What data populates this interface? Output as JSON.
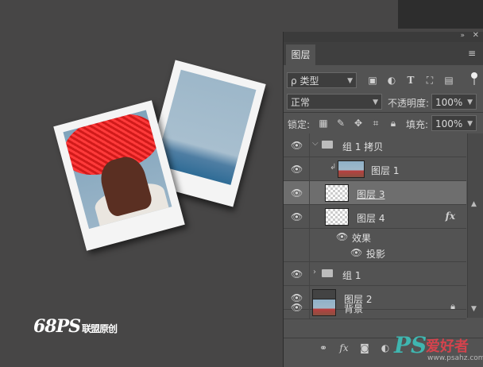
{
  "canvas": {
    "logo_main": "68PS",
    "logo_sub": "联盟原创"
  },
  "panel": {
    "collapse_icon": "»",
    "close_icon": "✕",
    "tab_label": "图层",
    "menu_icon": "≡",
    "filter": {
      "search_prefix": "ρ",
      "kind_value": "类型"
    },
    "blend_mode": "正常",
    "opacity_label": "不透明度:",
    "opacity_value": "100%",
    "lock_label": "锁定:",
    "fill_label": "填充:",
    "fill_value": "100%",
    "layers": [
      {
        "name": "组 1 拷贝",
        "type": "group",
        "expanded": true
      },
      {
        "name": "图层 1",
        "type": "clipped-photo"
      },
      {
        "name": "图层 3",
        "type": "pixel",
        "selected": true
      },
      {
        "name": "图层 4",
        "type": "pixel",
        "fx": "fx"
      },
      {
        "name": "效果",
        "type": "effects-header"
      },
      {
        "name": "投影",
        "type": "effect"
      },
      {
        "name": "组 1",
        "type": "group",
        "expanded": false
      },
      {
        "name": "图层 2",
        "type": "pixel"
      },
      {
        "name": "背景",
        "type": "background",
        "locked": true
      }
    ]
  },
  "watermark": {
    "brand": "PS",
    "cn_text": "爱好者",
    "url": "www.psahz.com"
  }
}
